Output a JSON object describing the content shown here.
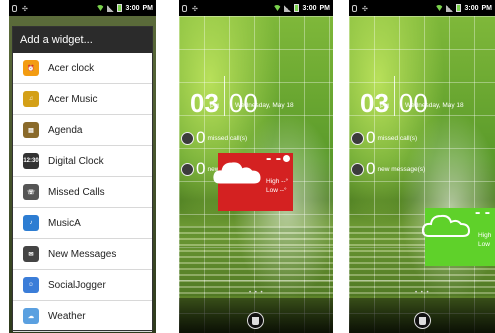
{
  "status_bar": {
    "time": "3:00",
    "ampm": "PM"
  },
  "picker": {
    "title": "Add a widget...",
    "items": [
      {
        "label": "Acer clock",
        "icon": "clock-icon",
        "color": "#f39c12",
        "glyph": "⏰"
      },
      {
        "label": "Acer Music",
        "icon": "music-icon",
        "color": "#d4a017",
        "glyph": "♫"
      },
      {
        "label": "Agenda",
        "icon": "agenda-icon",
        "color": "#8a6a2a",
        "glyph": "▤"
      },
      {
        "label": "Digital Clock",
        "icon": "digital-clock-icon",
        "color": "#333333",
        "glyph": "12:30"
      },
      {
        "label": "Missed Calls",
        "icon": "missed-calls-icon",
        "color": "#555555",
        "glyph": "☏"
      },
      {
        "label": "MusicA",
        "icon": "musica-icon",
        "color": "#2d7dd2",
        "glyph": "♪"
      },
      {
        "label": "New Messages",
        "icon": "messages-icon",
        "color": "#444444",
        "glyph": "✉"
      },
      {
        "label": "SocialJogger",
        "icon": "socialjogger-icon",
        "color": "#3b7dd8",
        "glyph": "☺"
      },
      {
        "label": "Weather",
        "icon": "weather-icon",
        "color": "#5aa0e0",
        "glyph": "☁"
      }
    ]
  },
  "home": {
    "hours": "03",
    "minutes": "00",
    "ampm": "PM",
    "date": "Wednesday, May 18",
    "missed_count": "0",
    "missed_label": "missed call(s)",
    "message_count": "0",
    "message_label": "new message(s)",
    "weather_dash": "- -",
    "weather_high": "High --°",
    "weather_low": "Low --°",
    "weather_high_short": "High",
    "weather_low_short": "Low",
    "page_dots": "• • •"
  },
  "colors": {
    "delete_zone": "#d42121",
    "drop_zone": "#5fd12a"
  }
}
